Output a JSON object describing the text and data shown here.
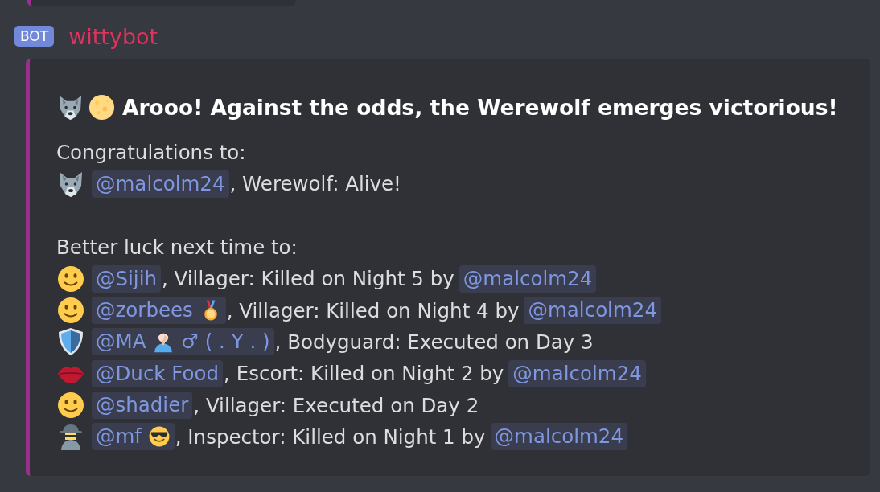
{
  "author": {
    "badge": "BOT",
    "name": "wittybot"
  },
  "embed": {
    "title": "Arooo! Against the odds, the Werewolf emerges victorious!",
    "winners_heading": "Congratulations to:",
    "winners": [
      {
        "kind": "wolf",
        "mention": {
          "text": "@malcolm24"
        },
        "detail": ", Werewolf: Alive!"
      }
    ],
    "losers_heading": "Better luck next time to:",
    "losers": [
      {
        "kind": "smiley",
        "mention": {
          "text": "@Sijih"
        },
        "detail": ", Villager: Killed on Night 5 by",
        "killer": "@malcolm24"
      },
      {
        "kind": "smiley",
        "mention": {
          "text": "@zorbees",
          "kind": "medal"
        },
        "detail": ", Villager: Killed on Night 4 by",
        "killer": "@malcolm24"
      },
      {
        "kind": "shield",
        "mention": {
          "text": "@MA",
          "kind": "person",
          "suffix": "♂ ( . Y . )"
        },
        "detail": ", Bodyguard: Executed on Day 3"
      },
      {
        "kind": "lips",
        "mention": {
          "text": "@Duck Food"
        },
        "detail": ", Escort: Killed on Night 2 by",
        "killer": "@malcolm24"
      },
      {
        "kind": "smiley",
        "mention": {
          "text": "@shadier"
        },
        "detail": ", Villager: Executed on Day 2"
      },
      {
        "kind": "detective",
        "mention": {
          "text": "@mf",
          "kind": "sunglasses"
        },
        "detail": ", Inspector: Killed on Night 1 by",
        "killer": "@malcolm24"
      }
    ]
  }
}
